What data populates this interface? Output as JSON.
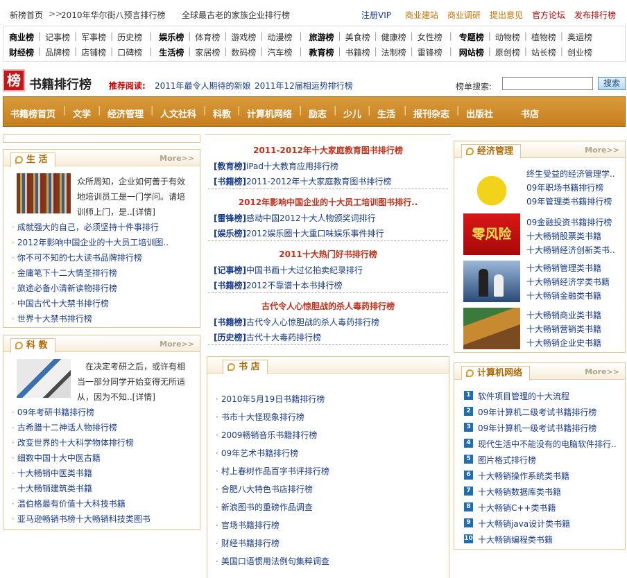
{
  "topbar": {
    "home": "新榜首页",
    "arrow": ">>",
    "crumb": "2010年华尔街八预言排行榜",
    "headline": "全球最古老的家族企业排行榜",
    "links": [
      {
        "label": "注册VIP",
        "color": "#1a3b8a"
      },
      {
        "label": "商业建站",
        "color": "#c87000"
      },
      {
        "label": "商业调研",
        "color": "#c87000"
      },
      {
        "label": "提出意见",
        "color": "#c87000"
      },
      {
        "label": "官方论坛",
        "color": "#c00000"
      },
      {
        "label": "发布排行榜",
        "color": "#c00000"
      }
    ]
  },
  "categories": {
    "row1": [
      [
        "商业榜",
        "记事榜",
        "军事榜",
        "历史榜"
      ],
      [
        "娱乐榜",
        "体育榜",
        "游戏榜",
        "动漫榜"
      ],
      [
        "旅游榜",
        "美食榜",
        "健康榜",
        "女性榜"
      ],
      [
        "专题榜",
        "动物榜",
        "植物榜",
        "奥运榜"
      ]
    ],
    "row2": [
      [
        "财经榜",
        "品牌榜",
        "店铺榜",
        "口碑榜"
      ],
      [
        "生活榜",
        "家居榜",
        "数码榜",
        "汽车榜"
      ],
      [
        "教育榜",
        "书籍榜",
        "法制榜",
        "雷锋榜"
      ],
      [
        "网站榜",
        "原创榜",
        "站长榜",
        "创业榜"
      ]
    ]
  },
  "header": {
    "logo_char": "榜",
    "title": "书籍排行榜",
    "recommend_label": "推荐阅读:",
    "recommend": [
      "2011年最令人期待的新娘",
      "2011年12届相运势排行榜"
    ],
    "search_label": "榜单搜索:",
    "search_value": "",
    "search_button": "搜索"
  },
  "nav": [
    "书籍榜首页",
    "文学",
    "经济管理",
    "人文社科",
    "科教",
    "计算机网络",
    "励志",
    "少儿",
    "生活",
    "报刊杂志",
    "出版社",
    "书店"
  ],
  "more_label": "More>>",
  "life": {
    "title": "生 活",
    "intro": [
      "众所周知，企业如何善于有效",
      "地培训员工是一门学问。请培",
      "训师上门，是..[详情]"
    ],
    "items": [
      "成就强大的自己，必须坚持十件事排行",
      "2012年影响中国企业的十大员工培训图..",
      "你不可不知的七大读书品牌排行榜",
      "金庸笔下十二大情圣排行榜",
      "旅途必备小清新读物排行榜",
      "中国古代十大禁书排行榜",
      "世界十大禁书排行榜"
    ]
  },
  "science": {
    "title": "科 教",
    "intro": [
      "在决定考研之后，或许有相",
      "当一部分同学开始变得无所适",
      "从，因为不知..[详情]"
    ],
    "items": [
      "09年考研书籍排行榜",
      "古希腊十二神话人物排行榜",
      "改变世界的十大科学物体排行榜",
      "细数中国十大中医古籍",
      "十大畅销中医类书籍",
      "十大畅销建筑类书籍",
      "温伯格最有价值十大科技书籍",
      "亚马逊畅销书榜十大畅销科技类图书"
    ]
  },
  "center": {
    "groups": [
      {
        "title": "2011-2012年十大家庭教育图书排行榜",
        "rows": [
          {
            "tag": "[教育榜]",
            "text": "iPad十大教育应用排行榜"
          },
          {
            "tag": "[书籍榜]",
            "text": "2011-2012年十大家庭教育图书排行榜"
          }
        ]
      },
      {
        "title": "2012年影响中国企业的十大员工培训图书排行..",
        "rows": [
          {
            "tag": "[雷锋榜]",
            "text": "感动中国2012十大人物颁奖词排行"
          },
          {
            "tag": "[娱乐榜]",
            "text": "2012娱乐圈十大重口味娱乐事件排行"
          }
        ]
      },
      {
        "title": "2011十大热门好书排行榜",
        "rows": [
          {
            "tag": "[记事榜]",
            "text": "中国书画十大过亿拍卖纪录排行"
          },
          {
            "tag": "[书籍榜]",
            "text": "2012不靠谱十本书排行榜"
          }
        ]
      },
      {
        "title": "古代令人心惊胆战的杀人毒药排行榜",
        "rows": [
          {
            "tag": "[书籍榜]",
            "text": "古代令人心惊胆战的杀人毒药排行榜"
          },
          {
            "tag": "[历史榜]",
            "text": "古代十大毒药排行榜"
          }
        ]
      }
    ]
  },
  "bookstore": {
    "title": "书 店",
    "items": [
      "2010年5月19日书籍排行榜",
      "书市十大怪现象排行榜",
      "2009畅销音乐书籍排行榜",
      "09年艺术书籍排行榜",
      "村上春树作品百字书评排行榜",
      "合肥八大特色书店排行榜",
      "新浪图书的重磅作品调查",
      "官场书籍排行榜",
      "财经书籍排行榜",
      "美国口语惯用法例句集粹调查"
    ]
  },
  "economy": {
    "title": "经济管理",
    "blocks": [
      [
        "终生受益的经济管理学..",
        "09年职场书籍排行榜",
        "09年管理类书籍排行榜"
      ],
      [
        "09金融投资书籍排行榜",
        "十大畅销股票类书籍",
        "十大畅销经济创新类书.."
      ],
      [
        "十大畅销管理类书籍",
        "十大畅销经济学类书籍",
        "十大畅销金融类书籍"
      ],
      [
        "十大畅销商业类书籍",
        "十大畅销营销类书籍",
        "十大畅销企业史书籍"
      ]
    ],
    "pic2_text": "零风险"
  },
  "computer": {
    "title": "计算机网络",
    "items": [
      "软件项目管理的十大流程",
      "09年计算机二级考试书籍排行榜",
      "09年计算机一级考试书籍排行榜",
      "现代生活中不能没有的电脑软件排行..",
      "图片格式排行榜",
      "十大畅销操作系统类书籍",
      "十大畅销数据库类书籍",
      "十大畅销C++类书籍",
      "十大畅销java设计类书籍",
      "十大畅销编程类书籍"
    ]
  }
}
